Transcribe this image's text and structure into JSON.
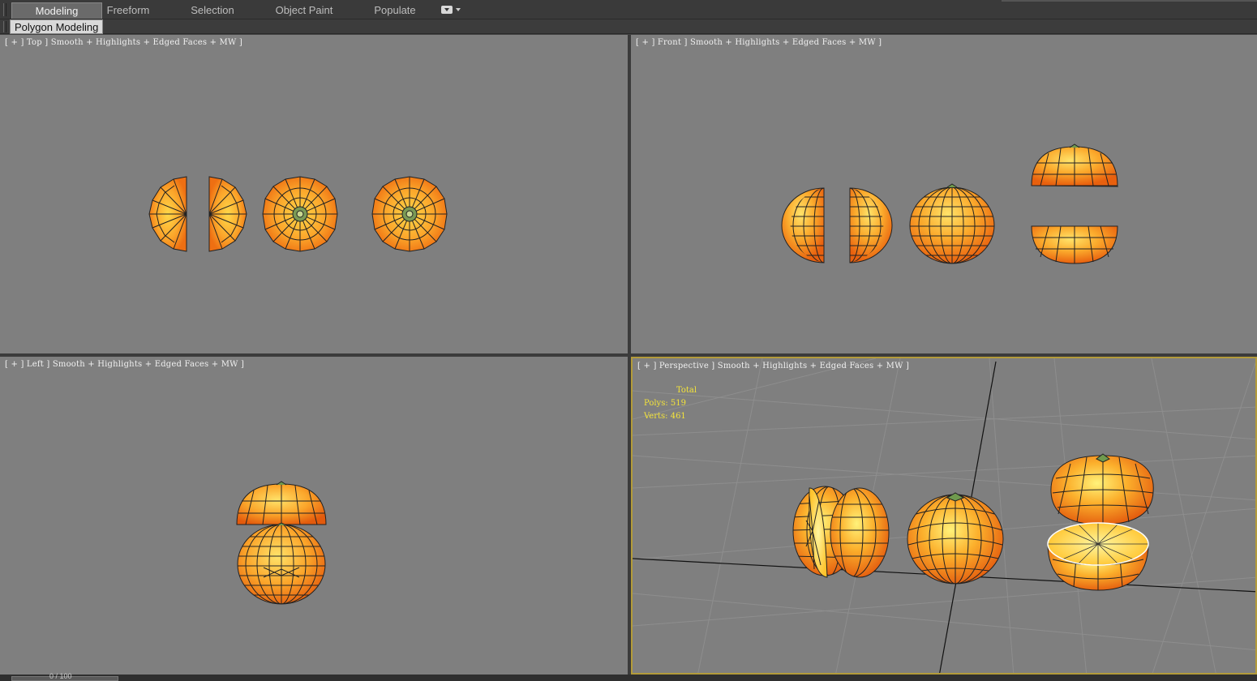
{
  "ribbon": {
    "tabs": [
      {
        "label": "Modeling",
        "active": true
      },
      {
        "label": "Freeform",
        "active": false
      },
      {
        "label": "Selection",
        "active": false
      },
      {
        "label": "Object Paint",
        "active": false
      },
      {
        "label": "Populate",
        "active": false
      }
    ],
    "panel_label": "Polygon Modeling"
  },
  "viewports": {
    "top": {
      "label": "[ + ] Top ] Smooth + Highlights + Edged Faces + MW ]"
    },
    "front": {
      "label": "[ + ] Front ] Smooth + Highlights + Edged Faces + MW ]"
    },
    "left": {
      "label": "[ + ] Left ] Smooth + Highlights + Edged Faces + MW ]"
    },
    "perspective": {
      "label": "[ + ] Perspective ] Smooth + Highlights + Edged Faces + MW ]",
      "active": true,
      "stats": {
        "title": "Total",
        "polys": "Polys: 519",
        "verts": "Verts: 461"
      }
    }
  },
  "time_slider": {
    "label": "0 / 100"
  },
  "colors": {
    "viewport_bg": "#7f7f7f",
    "orange_light": "#ffcf3a",
    "orange_dark": "#ec6a10",
    "active_border": "#b39b3a",
    "stats_text": "#f4e43a"
  }
}
